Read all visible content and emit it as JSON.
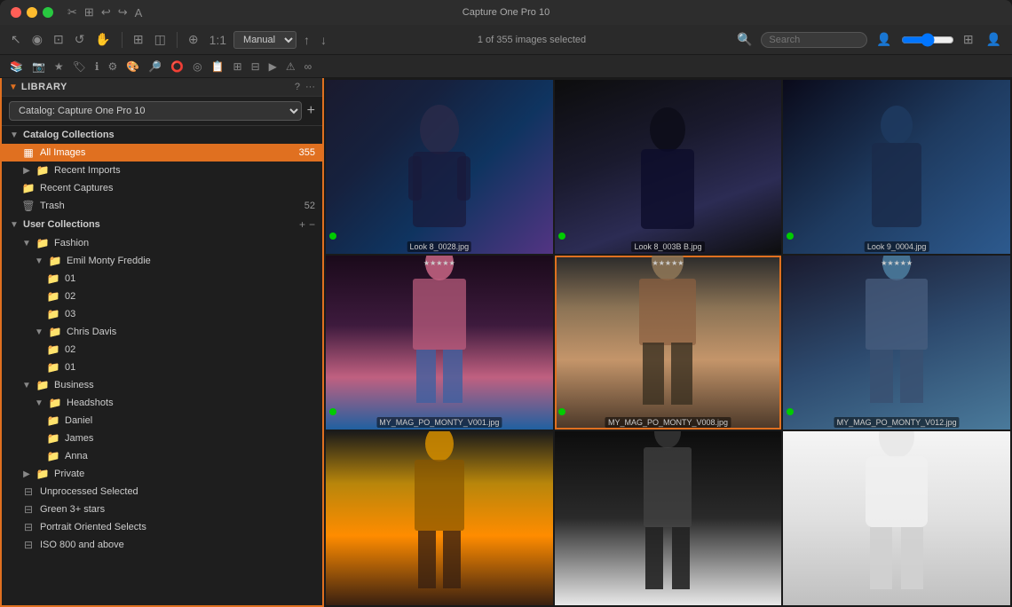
{
  "app": {
    "title": "Capture One Pro 10",
    "window_controls": [
      "close",
      "minimize",
      "maximize"
    ]
  },
  "toolbar": {
    "status_text": "1 of 355 images selected",
    "search_placeholder": "Search",
    "view_mode": "Manual"
  },
  "sidebar": {
    "title": "LIBRARY",
    "catalog_name": "Catalog: Capture One Pro 10",
    "sections": {
      "catalog_collections": {
        "label": "Catalog Collections",
        "items": [
          {
            "label": "All Images",
            "count": "355",
            "active": true,
            "icon": "grid"
          },
          {
            "label": "Recent Imports",
            "count": "",
            "active": false,
            "icon": "folder"
          },
          {
            "label": "Recent Captures",
            "count": "",
            "active": false,
            "icon": "folder"
          },
          {
            "label": "Trash",
            "count": "52",
            "active": false,
            "icon": "trash"
          }
        ]
      },
      "user_collections": {
        "label": "User Collections",
        "items": [
          {
            "label": "Fashion",
            "indent": 1,
            "icon": "folder-group"
          },
          {
            "label": "Emil Monty Freddie",
            "indent": 2,
            "icon": "folder"
          },
          {
            "label": "01",
            "indent": 3,
            "icon": "folder"
          },
          {
            "label": "02",
            "indent": 3,
            "icon": "folder"
          },
          {
            "label": "03",
            "indent": 3,
            "icon": "folder"
          },
          {
            "label": "Chris Davis",
            "indent": 2,
            "icon": "folder"
          },
          {
            "label": "02",
            "indent": 3,
            "icon": "folder"
          },
          {
            "label": "01",
            "indent": 3,
            "icon": "folder"
          },
          {
            "label": "Business",
            "indent": 1,
            "icon": "folder-group"
          },
          {
            "label": "Headshots",
            "indent": 2,
            "icon": "folder"
          },
          {
            "label": "Daniel",
            "indent": 3,
            "icon": "folder"
          },
          {
            "label": "James",
            "indent": 3,
            "icon": "folder"
          },
          {
            "label": "Anna",
            "indent": 3,
            "icon": "folder"
          },
          {
            "label": "Private",
            "indent": 1,
            "icon": "folder-group"
          }
        ]
      },
      "smart_collections": {
        "items": [
          {
            "label": "Unprocessed Selected",
            "icon": "smart"
          },
          {
            "label": "Green 3+ stars",
            "icon": "smart"
          },
          {
            "label": "Portrait Oriented Selects",
            "icon": "smart"
          },
          {
            "label": "ISO 800 and above",
            "icon": "smart"
          }
        ]
      }
    }
  },
  "photo_grid": {
    "rows": [
      [
        {
          "filename": "",
          "style": "photo-1",
          "stars": "",
          "label": "Look 8_0028.jpg"
        },
        {
          "filename": "",
          "style": "photo-2",
          "stars": "",
          "label": "Look 8_003B B.jpg"
        },
        {
          "filename": "",
          "style": "photo-3",
          "stars": "",
          "label": "Look 9_0004.jpg"
        }
      ],
      [
        {
          "filename": "",
          "style": "photo-4",
          "stars": "★★★★★",
          "label": "MY_MAG_PO_MONTY_V001.jpg",
          "selected": false
        },
        {
          "filename": "",
          "style": "photo-5",
          "stars": "★★★★★",
          "label": "MY_MAG_PO_MONTY_V008.jpg",
          "selected": true
        },
        {
          "filename": "",
          "style": "photo-6",
          "stars": "★★★★★",
          "label": "MY_MAG_PO_MONTY_V012.jpg",
          "selected": false
        }
      ],
      [
        {
          "filename": "",
          "style": "photo-7",
          "stars": "",
          "label": "",
          "selected": false
        },
        {
          "filename": "",
          "style": "photo-8",
          "stars": "",
          "label": "",
          "selected": false
        },
        {
          "filename": "",
          "style": "photo-9",
          "stars": "",
          "label": "",
          "selected": false
        }
      ]
    ]
  },
  "icons": {
    "chevron_right": "▶",
    "chevron_down": "▼",
    "folder": "📁",
    "trash": "🗑",
    "grid": "▦",
    "plus": "+",
    "minus": "−",
    "question": "?",
    "ellipsis": "···",
    "search": "🔍"
  }
}
